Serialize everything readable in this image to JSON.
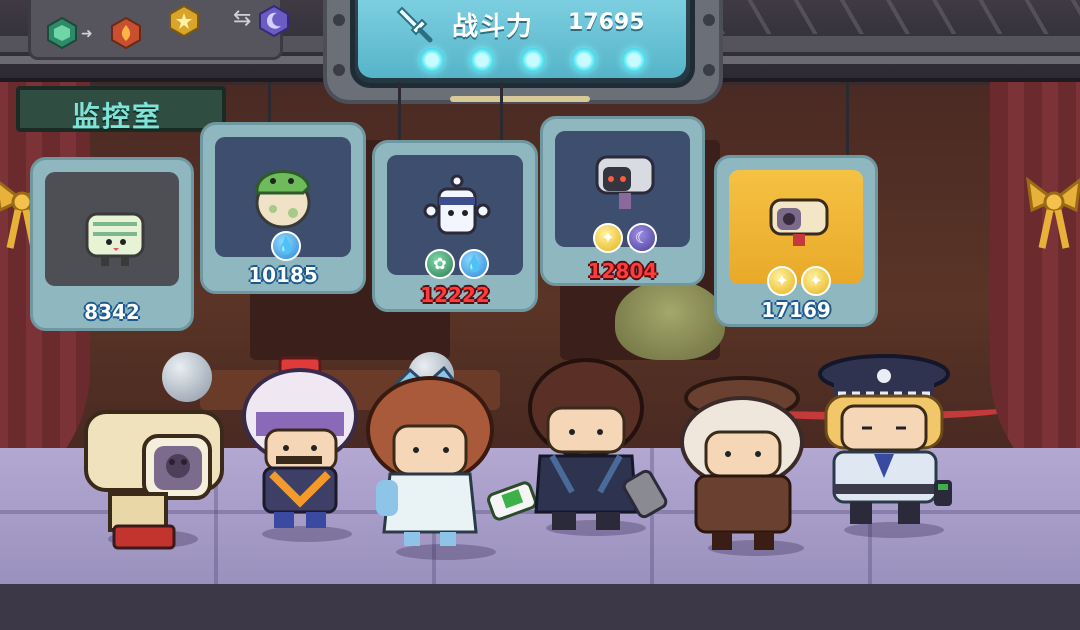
{
  "power_banner": {
    "label": "战斗力",
    "value": "17695",
    "slots": 5,
    "accent": "#56e6f3"
  },
  "room": {
    "label": "监控室"
  },
  "element_panel": {
    "icons": [
      "nature-hex-icon",
      "fire-hex-icon",
      "star-hex-icon",
      "moon-hex-icon"
    ],
    "swap_icon": "⇆"
  },
  "enemy_cards": [
    {
      "name": "tissue-box-monster",
      "power": "8342",
      "power_color": "blue",
      "elements": [],
      "frame": "gray"
    },
    {
      "name": "green-dino-egg",
      "power": "10185",
      "power_color": "blue",
      "elements": [
        "water"
      ],
      "frame": "blue"
    },
    {
      "name": "white-ghost-bot",
      "power": "12222",
      "power_color": "red",
      "elements": [
        "nature",
        "water"
      ],
      "frame": "blue"
    },
    {
      "name": "dark-security-camera",
      "power": "12804",
      "power_color": "red",
      "elements": [
        "star",
        "moon"
      ],
      "frame": "blue"
    },
    {
      "name": "beige-security-camera",
      "power": "17169",
      "power_color": "blue",
      "elements": [
        "star",
        "star"
      ],
      "frame": "gold"
    }
  ],
  "party": [
    {
      "name": "security-camera-robot"
    },
    {
      "name": "purple-helmet-worker"
    },
    {
      "name": "maid-girl-with-spray"
    },
    {
      "name": "dark-hair-boy-with-bottle"
    },
    {
      "name": "detective-girl"
    },
    {
      "name": "police-officer"
    }
  ],
  "colors": {
    "power_red": "#ff3b3b",
    "power_blue_outline": "#1b5a8f",
    "card_frame": "#8fb7c0",
    "gold_card": "#f5c244",
    "floor": "#b3a8d2"
  }
}
